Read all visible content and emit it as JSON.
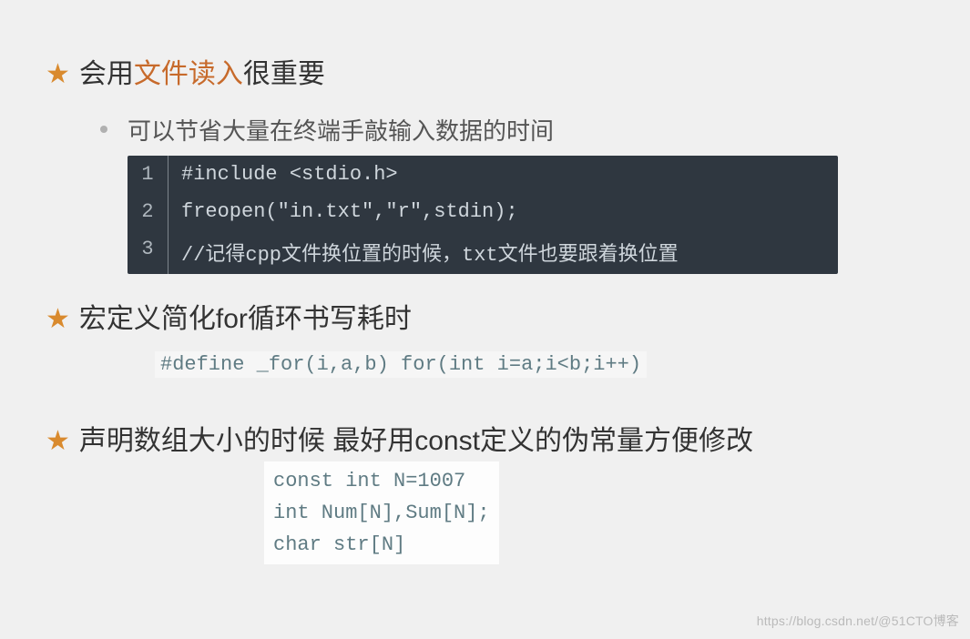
{
  "topic1": {
    "title_pre": "会用",
    "title_hl": "文件读入",
    "title_post": "很重要",
    "bullet": "可以节省大量在终端手敲输入数据的时间",
    "code": {
      "ln1": "1",
      "ln2": "2",
      "ln3": "3",
      "l1": "#include <stdio.h>",
      "l2": "freopen(\"in.txt\",\"r\",stdin);",
      "l3": "//记得cpp文件换位置的时候，txt文件也要跟着换位置"
    }
  },
  "topic2": {
    "title": "宏定义简化for循环书写耗时",
    "code": "#define _for(i,a,b) for(int i=a;i<b;i++)"
  },
  "topic3": {
    "title": "声明数组大小的时候 最好用const定义的伪常量方便修改",
    "code": "const int N=1007\nint Num[N],Sum[N];\nchar str[N]"
  },
  "watermark": "https://blog.csdn.net/@51CTO博客",
  "icons": {
    "star": "★",
    "dot": "•"
  }
}
